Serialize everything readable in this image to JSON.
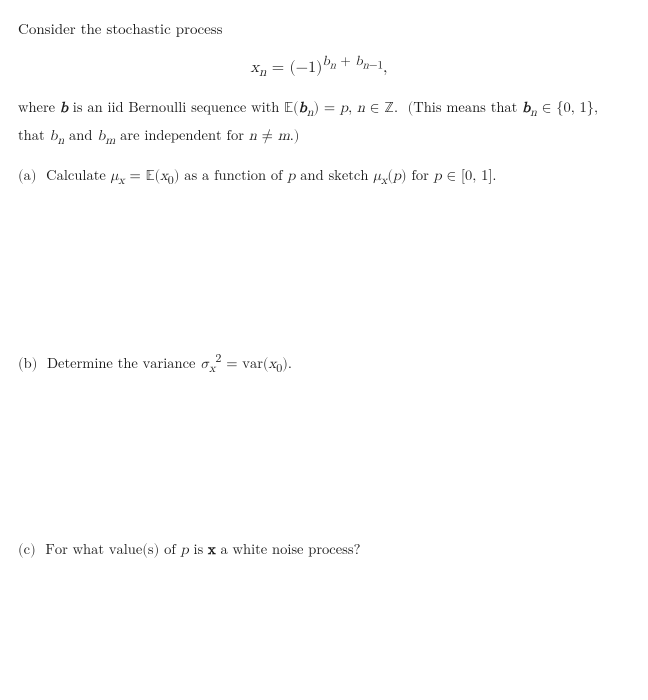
{
  "intro": {
    "text": "Consider the stochastic process"
  },
  "formula": {
    "display": "x_n = (−1)^{b_n + b_{n−1}},"
  },
  "description": {
    "line1": "where b is an iid Bernoulli sequence with",
    "E_bn_eq_p": "𝔼(b",
    "n_sub": "n",
    "close_paren": ") = p,",
    "n_in_Z": "n ∈ ℤ.",
    "parenthetical": "(This means that b",
    "bn_sub": "n",
    "in_set": "∈ {0, 1},",
    "line2": "that b",
    "bn2_sub": "n",
    "and_bm": "and b",
    "bm_sub": "m",
    "are_indep": "are independent for n ≠ m.)"
  },
  "parts": {
    "a": {
      "label": "(a)",
      "text1": "Calculate μ",
      "x_sub": "x",
      "text2": "= 𝔼(x",
      "x0_sub": "0",
      "text3": ") as a function of p and sketch μ",
      "mux_sub": "x",
      "text4": "(p) for p ∈ [0, 1]."
    },
    "b": {
      "label": "(b)",
      "text1": "Determine the variance σ",
      "x_sup": "2",
      "x_sub": "x",
      "text2": "= var(x",
      "x0_sub": "0",
      "text3": ")."
    },
    "c": {
      "label": "(c)",
      "text1": "For what value(s) of p is x a white noise process?"
    }
  },
  "colors": {
    "text": "#1a1a1a",
    "bg": "#ffffff"
  }
}
